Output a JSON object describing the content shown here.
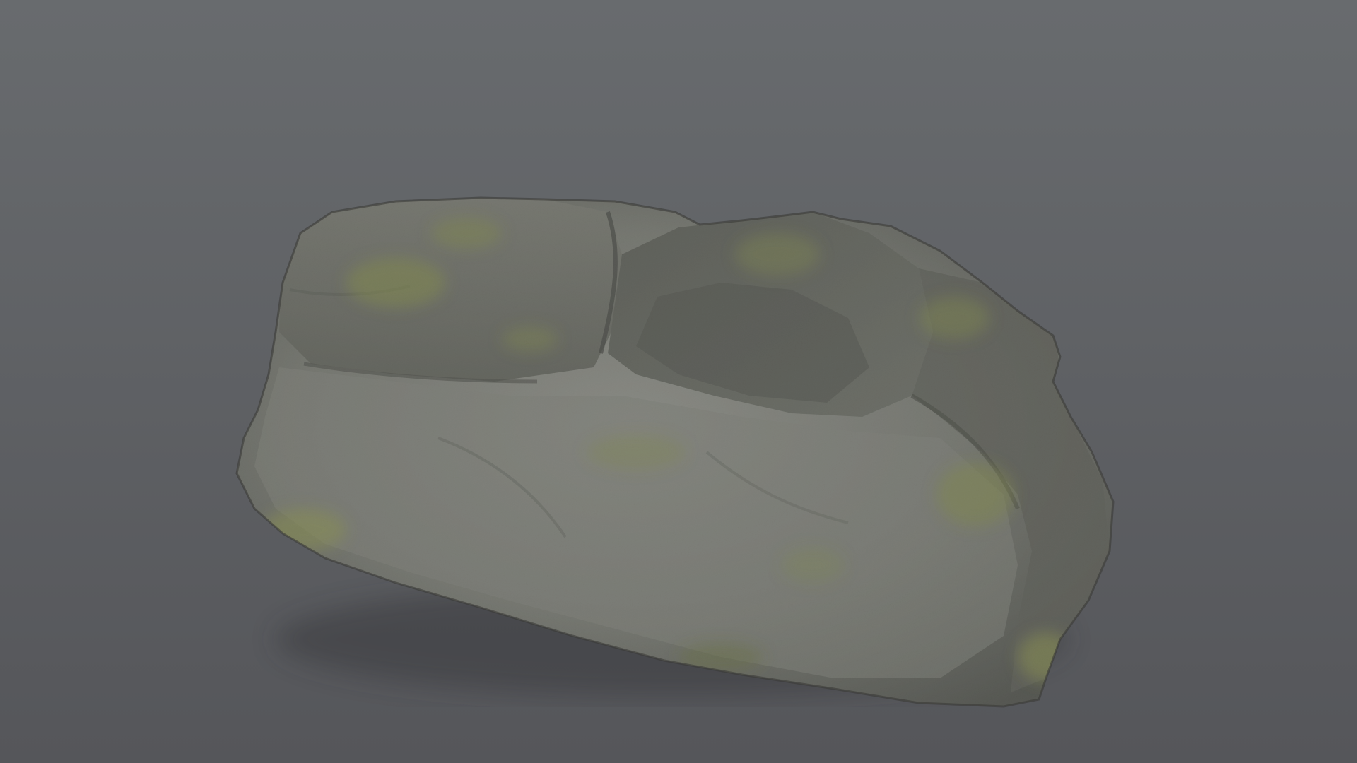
{
  "scene": {
    "subject": "moss-covered-rock",
    "colors": {
      "background_top": "#686b6e",
      "background_bottom": "#55565a",
      "rock_light": "#8a8b85",
      "rock_mid": "#6d6f68",
      "rock_dark": "#3e403b",
      "moss": "#7f8a34",
      "moss_dark": "#5c6628"
    }
  }
}
